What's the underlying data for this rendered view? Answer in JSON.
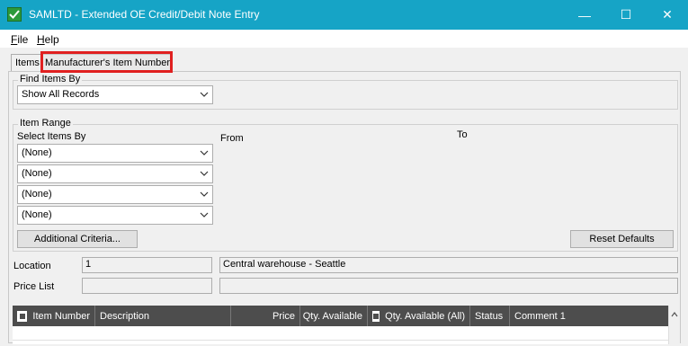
{
  "window": {
    "title": "SAMLTD - Extended OE Credit/Debit Note Entry",
    "accent_color": "#16a4c6",
    "buttons": {
      "minimize": "—",
      "maximize": "☐",
      "close": "✕"
    }
  },
  "menu": [
    {
      "label_under": "F",
      "label_rest": "ile"
    },
    {
      "label_under": "H",
      "label_rest": "elp"
    }
  ],
  "tabs": [
    {
      "label": "Items",
      "active": true
    },
    {
      "label": "Manufacturer's Item Number",
      "active": false,
      "highlighted": true
    }
  ],
  "find_items": {
    "group_title": "Find Items By",
    "selected": "Show All Records"
  },
  "item_range": {
    "group_title": "Item Range",
    "select_label": "Select Items By",
    "from_label": "From",
    "to_label": "To",
    "selectors": [
      "(None)",
      "(None)",
      "(None)",
      "(None)"
    ],
    "additional_criteria_label": "Additional Criteria...",
    "reset_defaults_label": "Reset Defaults"
  },
  "location": {
    "label": "Location",
    "value": "1",
    "description": "Central warehouse - Seattle"
  },
  "price_list": {
    "label": "Price List",
    "value": "",
    "description": ""
  },
  "grid": {
    "columns": [
      {
        "label": "Item Number",
        "icon": "flag-icon"
      },
      {
        "label": "Description"
      },
      {
        "label": "Price"
      },
      {
        "label": "Qty. Available"
      },
      {
        "label": "Qty. Available (All)",
        "icon": "flag-icon"
      },
      {
        "label": "Status"
      },
      {
        "label": "Comment 1"
      }
    ]
  }
}
